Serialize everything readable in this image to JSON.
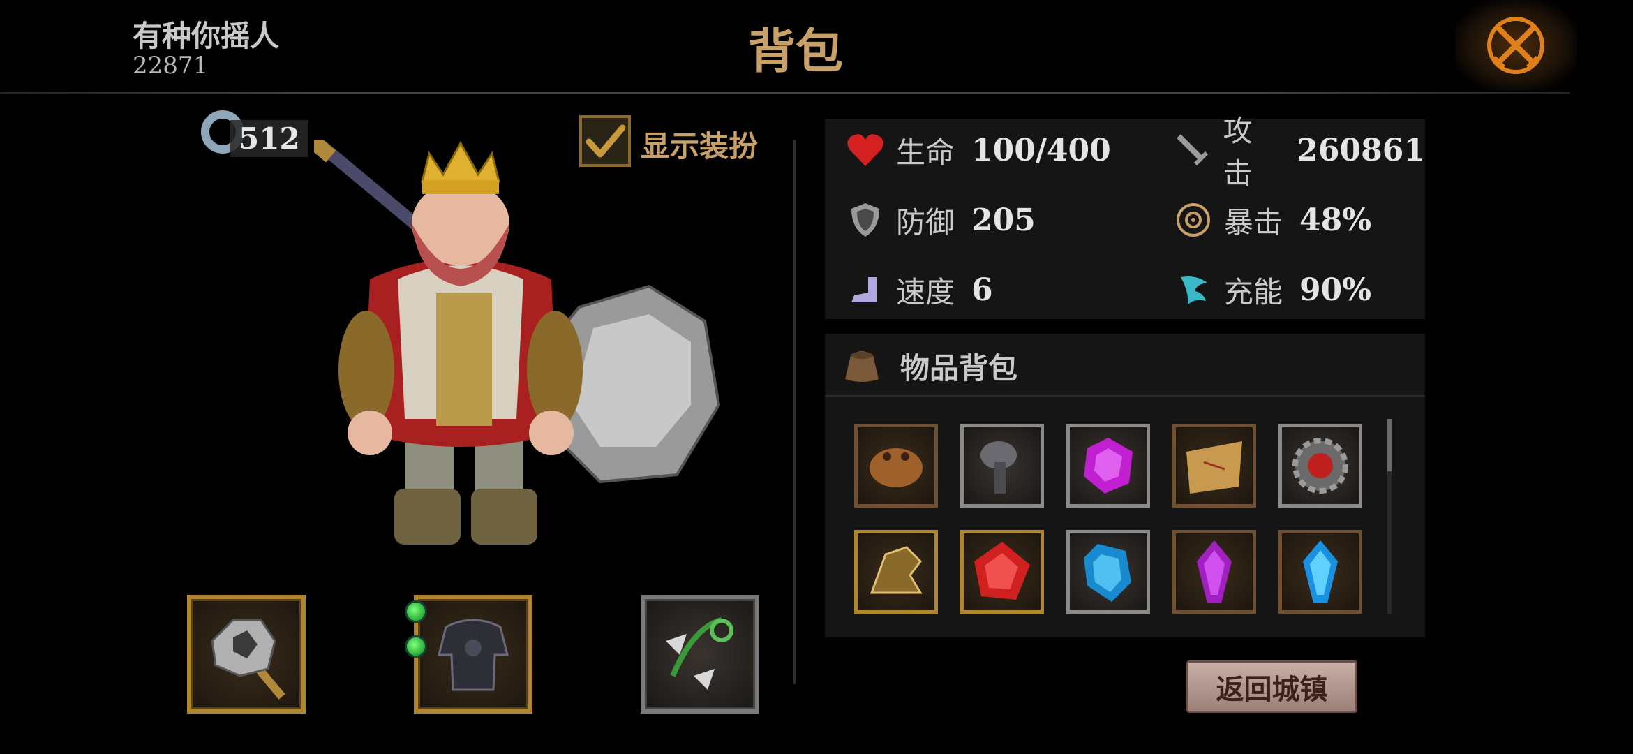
{
  "header": {
    "player_name": "有种你摇人",
    "player_id": "22871",
    "title": "背包",
    "close_icon": "crossed-swords-close-icon"
  },
  "character": {
    "level": "512",
    "show_costume_label": "显示装扮",
    "show_costume_checked": true
  },
  "equipment": [
    {
      "slot": "weapon",
      "icon": "war-hammer-icon",
      "frame": "gold"
    },
    {
      "slot": "armor",
      "icon": "dark-armor-icon",
      "frame": "gold"
    },
    {
      "slot": "accessory",
      "icon": "green-pendant-icon",
      "frame": "silver"
    }
  ],
  "stats": {
    "hp": {
      "label": "生命",
      "value": "100/400",
      "icon": "heart-icon"
    },
    "attack": {
      "label": "攻击",
      "value": "260861",
      "icon": "sword-icon"
    },
    "defense": {
      "label": "防御",
      "value": "205",
      "icon": "shield-icon"
    },
    "crit": {
      "label": "暴击",
      "value": "48%",
      "icon": "crit-target-icon"
    },
    "speed": {
      "label": "速度",
      "value": "6",
      "icon": "boot-icon"
    },
    "energy": {
      "label": "充能",
      "value": "90%",
      "icon": "energy-wing-icon"
    }
  },
  "inventory": {
    "title": "物品背包",
    "icon": "bag-icon",
    "items": [
      {
        "icon": "toad-icon",
        "frame": "bronze"
      },
      {
        "icon": "pipe-icon",
        "frame": "silver"
      },
      {
        "icon": "purple-gem-icon",
        "frame": "silver"
      },
      {
        "icon": "map-scroll-icon",
        "frame": "bronze"
      },
      {
        "icon": "red-gear-icon",
        "frame": "silver"
      },
      {
        "icon": "golden-boot-icon",
        "frame": "gold"
      },
      {
        "icon": "red-crystal-icon",
        "frame": "gold"
      },
      {
        "icon": "blue-crystal-icon",
        "frame": "silver"
      },
      {
        "icon": "purple-crystal-icon",
        "frame": "bronze"
      },
      {
        "icon": "cyan-crystal-icon",
        "frame": "bronze"
      }
    ]
  },
  "return_button": "返回城镇",
  "colors": {
    "title_gold": "#c8a06a",
    "panel_bg": "#151515",
    "gold_frame": "#b1852c"
  }
}
